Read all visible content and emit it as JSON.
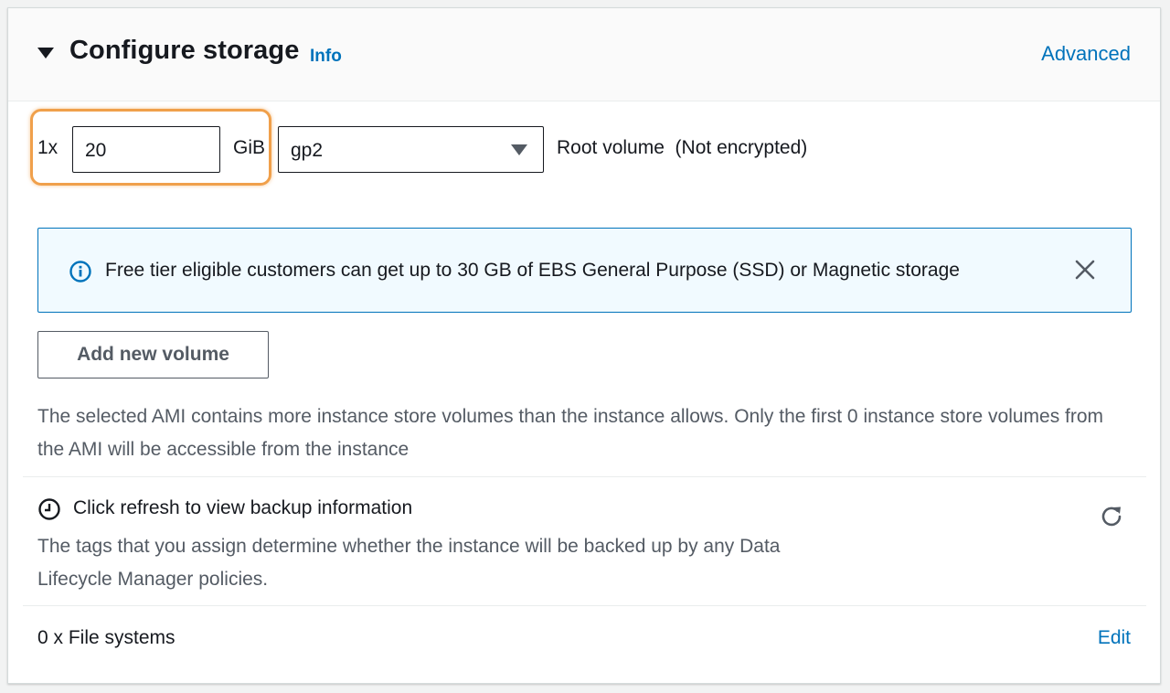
{
  "header": {
    "title": "Configure storage",
    "info_label": "Info",
    "advanced_label": "Advanced"
  },
  "volume": {
    "count_label": "1x",
    "size_value": "20",
    "unit_label": "GiB",
    "type_value": "gp2",
    "description": "Root volume  (Not encrypted)"
  },
  "alert": {
    "message": "Free tier eligible customers can get up to 30 GB of EBS General Purpose (SSD) or Magnetic storage"
  },
  "add_volume_label": "Add new volume",
  "ami_note": "The selected AMI contains more instance store volumes than the instance allows. Only the first 0 instance store volumes from the AMI will be accessible from the instance",
  "backup": {
    "title": "Click refresh to view backup information",
    "description": "The tags that you assign determine whether the instance will be backed up by any Data Lifecycle Manager policies."
  },
  "file_systems": {
    "label": "0 x File systems",
    "edit_label": "Edit"
  },
  "colors": {
    "link": "#0073bb",
    "alert_bg": "#f1faff",
    "highlight": "#f0a04b",
    "text_secondary": "#545b64"
  },
  "icons": {
    "collapse": "caret-down-icon",
    "info": "info-circle-icon",
    "close": "close-icon",
    "backup": "clock-icon",
    "refresh": "refresh-icon",
    "select": "chevron-down-icon"
  }
}
